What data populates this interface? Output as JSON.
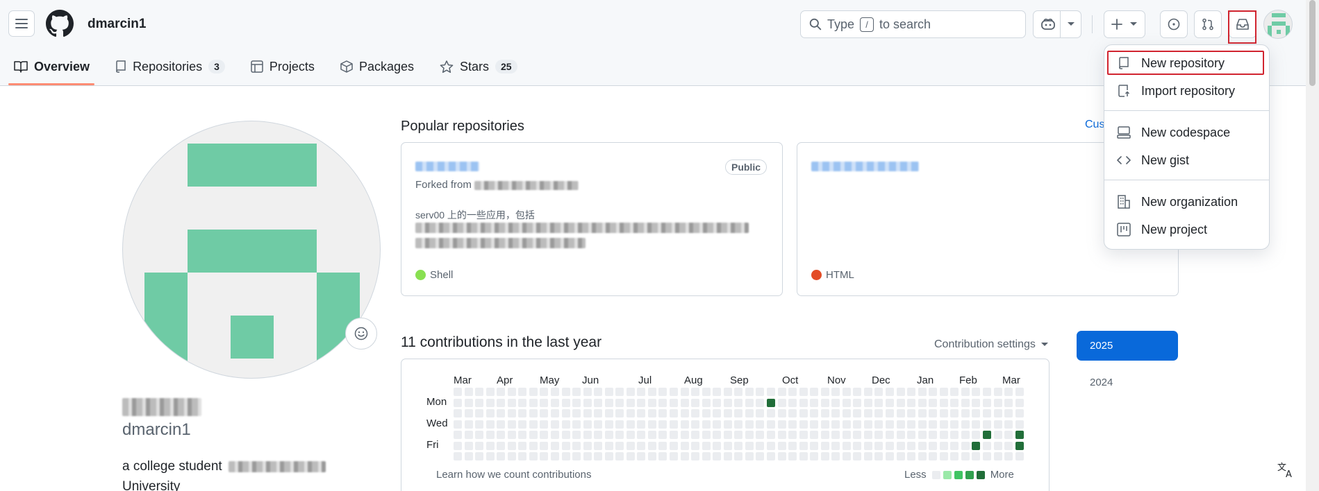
{
  "header": {
    "username": "dmarcin1",
    "search_prefix": "Type",
    "search_key": "/",
    "search_suffix": "to search"
  },
  "tabs": [
    {
      "label": "Overview"
    },
    {
      "label": "Repositories",
      "count": "3"
    },
    {
      "label": "Projects"
    },
    {
      "label": "Packages"
    },
    {
      "label": "Stars",
      "count": "25"
    }
  ],
  "profile": {
    "login": "dmarcin1",
    "bio_line1": "a college student",
    "bio_line2": "University"
  },
  "popular": {
    "title": "Popular repositories",
    "customize": "Cus",
    "repos": [
      {
        "visibility": "Public",
        "forked_from_label": "Forked from",
        "description": "serv00 上的一些应用，包括",
        "language": "Shell",
        "language_color": "#89e051"
      },
      {
        "language": "HTML",
        "language_color": "#e34c26"
      }
    ]
  },
  "contributions": {
    "title": "11 contributions in the last year",
    "settings_label": "Contribution settings",
    "months": [
      "Mar",
      "Apr",
      "May",
      "Jun",
      "Jul",
      "Aug",
      "Sep",
      "Oct",
      "Nov",
      "Dec",
      "Jan",
      "Feb",
      "Mar"
    ],
    "days": [
      "Mon",
      "Wed",
      "Fri"
    ],
    "learn": "Learn how we count contributions",
    "less": "Less",
    "more": "More",
    "years": [
      "2025",
      "2024"
    ],
    "colors": {
      "empty": "#ebedf0",
      "l1": "#9be9a8",
      "l2": "#40c463",
      "l3": "#30a14e",
      "l4": "#216e39",
      "accent": "#0969da"
    }
  },
  "menu": {
    "items": [
      {
        "label": "New repository",
        "icon": "repo-icon"
      },
      {
        "label": "Import repository",
        "icon": "repo-push-icon"
      },
      {
        "label": "New codespace",
        "icon": "codespaces-icon"
      },
      {
        "label": "New gist",
        "icon": "code-icon"
      },
      {
        "label": "New organization",
        "icon": "organization-icon"
      },
      {
        "label": "New project",
        "icon": "project-icon"
      }
    ]
  }
}
